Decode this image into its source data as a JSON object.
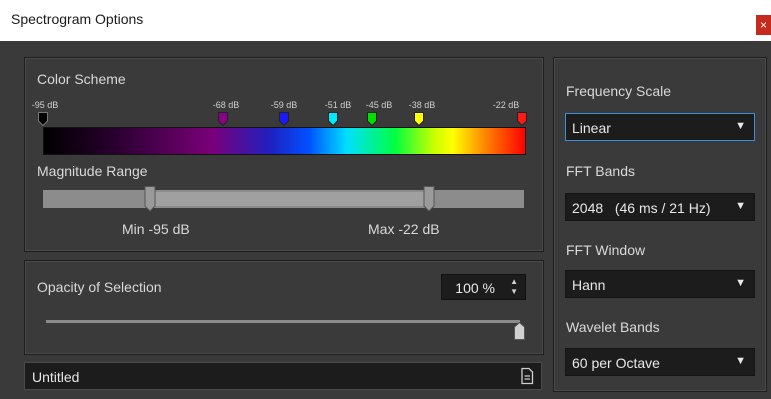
{
  "window": {
    "title": "Spectrogram Options",
    "close_glyph": "×"
  },
  "color_scheme": {
    "label": "Color Scheme",
    "markers": [
      {
        "label": "-95 dB",
        "color": "#000000"
      },
      {
        "label": "-68 dB",
        "color": "#8a008a"
      },
      {
        "label": "-59 dB",
        "color": "#1a1aff"
      },
      {
        "label": "-51 dB",
        "color": "#00e8ff"
      },
      {
        "label": "-45 dB",
        "color": "#00e000"
      },
      {
        "label": "-38 dB",
        "color": "#ffff00"
      },
      {
        "label": "-22 dB",
        "color": "#ff1a1a"
      }
    ]
  },
  "magnitude_range": {
    "label": "Magnitude Range",
    "min_label": "Min -95 dB",
    "max_label": "Max -22 dB"
  },
  "opacity": {
    "label": "Opacity of Selection",
    "value": "100 %",
    "level": 1.0
  },
  "preset": {
    "name": "Untitled"
  },
  "frequency_scale": {
    "label": "Frequency Scale",
    "value": "Linear"
  },
  "fft_bands": {
    "label": "FFT Bands",
    "value": "2048   (46 ms / 21 Hz)"
  },
  "fft_window": {
    "label": "FFT Window",
    "value": "Hann"
  },
  "wavelet_bands": {
    "label": "Wavelet Bands",
    "value": "60 per Octave"
  },
  "icons": {
    "dropdown": "triangle-down",
    "spinner": "up-down-arrows",
    "preset_menu": "document-icon"
  }
}
